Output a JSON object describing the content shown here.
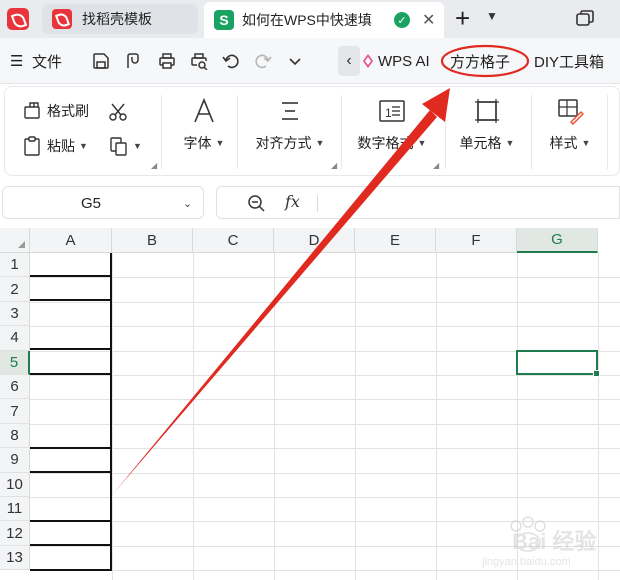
{
  "tabbar": {
    "home_icon": "wps-logo-icon",
    "tabs": [
      {
        "label": "找稻壳模板",
        "icon": "docer-logo-icon"
      },
      {
        "label": "如何在WPS中快速填",
        "icon": "spreadsheet-s-icon",
        "active": true
      }
    ],
    "new_tab_symbol": "+",
    "dropdown_symbol": "⌄"
  },
  "menubar": {
    "file_label": "文件",
    "quick_access_icons": [
      "save-icon",
      "export-icon",
      "print-icon",
      "print-preview-icon",
      "undo-icon",
      "redo-icon",
      "more-chevron-icon"
    ],
    "ribbon_tabs": [
      {
        "label": "WPS AI"
      },
      {
        "label": "方方格子",
        "highlighted": true
      },
      {
        "label": "DIY工具箱"
      }
    ]
  },
  "ribbon": {
    "format_painter": "格式刷",
    "cut_icon": "scissors-icon",
    "paste": "粘贴",
    "copy_icon": "copy-icon",
    "groups": [
      {
        "label": "字体",
        "icon": "font-a-icon"
      },
      {
        "label": "对齐方式",
        "icon": "align-icon"
      },
      {
        "label": "数字格式",
        "icon": "number-format-icon"
      },
      {
        "label": "单元格",
        "icon": "cell-border-icon"
      },
      {
        "label": "样式",
        "icon": "style-brush-icon"
      }
    ]
  },
  "formula_bar": {
    "name_box": "G5",
    "fx_label": "fx",
    "formula": ""
  },
  "sheet": {
    "columns": [
      "A",
      "B",
      "C",
      "D",
      "E",
      "F",
      "G"
    ],
    "active_column": "G",
    "rows": [
      "1",
      "2",
      "3",
      "4",
      "5",
      "6",
      "7",
      "8",
      "9",
      "10",
      "11",
      "12",
      "13"
    ],
    "active_row": "5",
    "selected_cell": "G5"
  },
  "annotation": {
    "color": "#e02a20",
    "target": "方方格子"
  },
  "watermark": {
    "text": "Bai 经验",
    "subtext": "jingyan.baidu.com"
  },
  "colors": {
    "accent_green": "#1f7c4d",
    "brand_red": "#e8353b",
    "spreadsheet_green": "#1aa263"
  }
}
